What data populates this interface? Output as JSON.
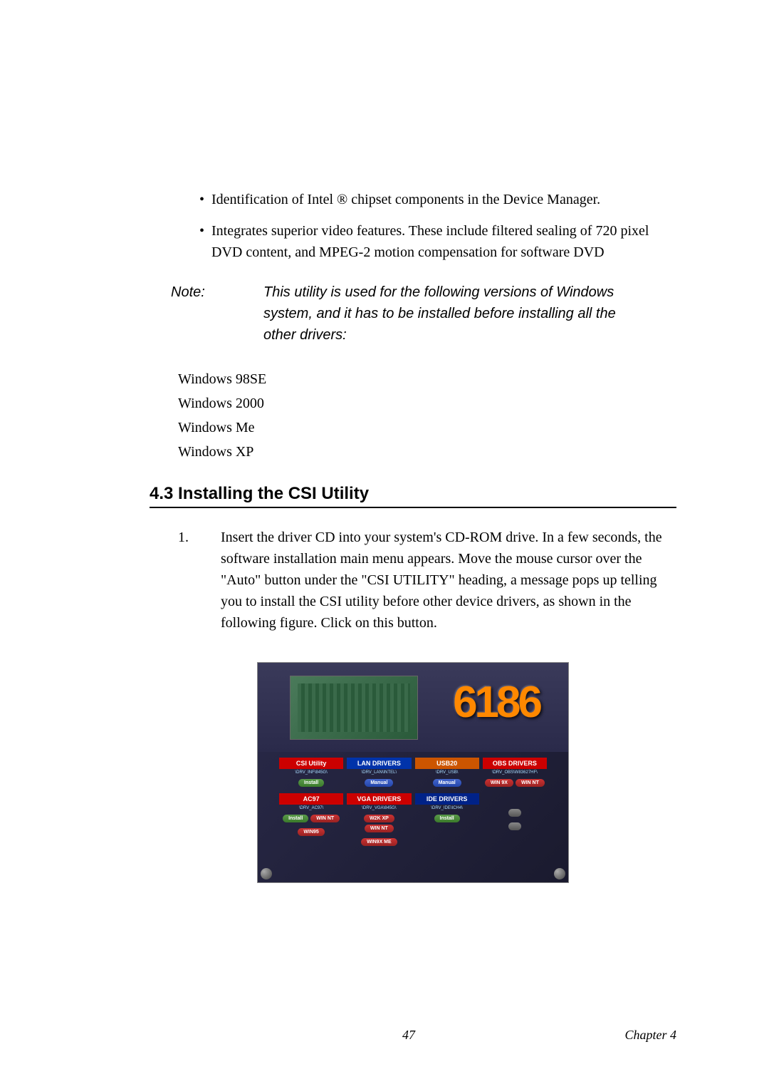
{
  "bullets": [
    "Identification of Intel ® chipset components in the Device Manager.",
    "Integrates superior video features. These include filtered sealing of 720 pixel DVD content, and MPEG-2 motion compensation for software DVD"
  ],
  "note": {
    "label": "Note:",
    "text": "This utility is used for the following versions of Windows system, and it has to be installed before installing all the other drivers:"
  },
  "os_list": [
    "Windows 98SE",
    "Windows 2000",
    "Windows Me",
    "Windows XP"
  ],
  "section_heading": "4.3  Installing the CSI Utility",
  "step": {
    "number": "1.",
    "text": "Insert the driver CD into your system's CD-ROM drive. In a few seconds, the software installation main menu appears. Move the mouse cursor over the \"Auto\" button under the \"CSI UTILITY\" heading, a message pops up telling you to install the CSI utility before other device drivers, as shown in the following figure. Click on this button."
  },
  "installer": {
    "logo": "6186",
    "panels": {
      "csi": {
        "title": "CSI Utility",
        "path": "\\DRV_INF\\845G\\",
        "btn1": "Install"
      },
      "lan": {
        "title": "LAN DRIVERS",
        "path": "\\DRV_LAN\\INTEL\\",
        "btn1": "Manual"
      },
      "usb": {
        "title": "USB20",
        "path": "\\DRV_USB\\",
        "btn1": "Manual"
      },
      "obs": {
        "title": "OBS DRIVERS",
        "path": "\\DRV_OBS\\W83627HF\\",
        "btn1": "WIN 9X",
        "btn2": "WIN NT"
      },
      "ac97": {
        "title": "AC97",
        "path": "\\DRV_AC97\\",
        "btn1": "Install",
        "btn2": "WIN NT",
        "btn3": "WIN95"
      },
      "vga": {
        "title": "VGA DRIVERS",
        "path": "\\DRV_VGA\\845G\\",
        "btn1": "W2K XP",
        "btn2": "WIN NT",
        "btn3": "WIN9X ME"
      },
      "ide": {
        "title": "IDE DRIVERS",
        "path": "\\DRV_IDE\\ICH4\\",
        "btn1": "Install"
      }
    }
  },
  "footer": {
    "page": "47",
    "chapter": "Chapter 4"
  }
}
